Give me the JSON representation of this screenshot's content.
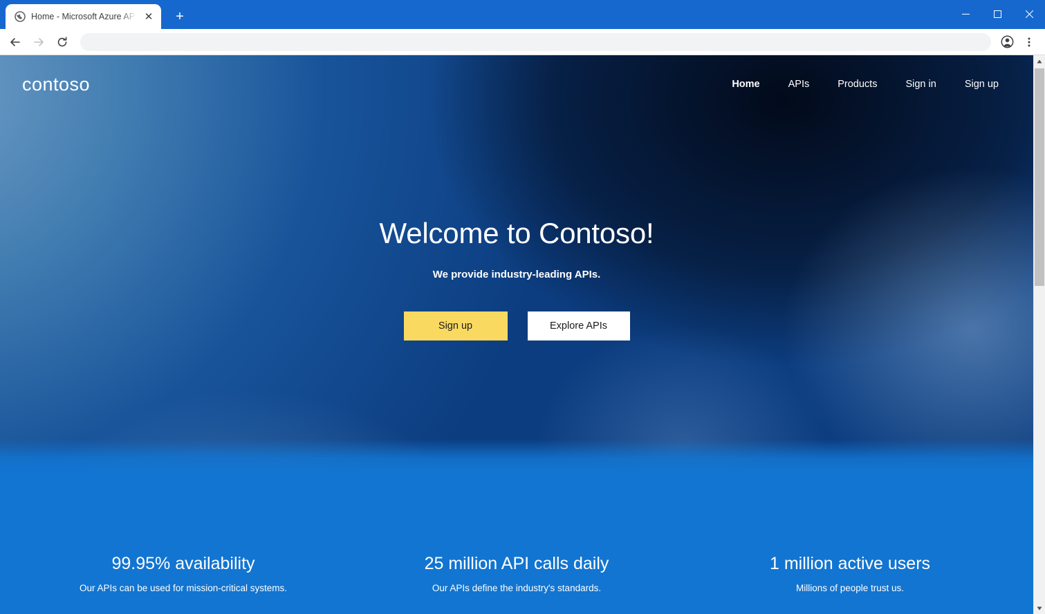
{
  "browser": {
    "tab": {
      "title": "Home - Microsoft Azure API Man",
      "favicon": "globe-icon",
      "close_label": "✕"
    },
    "new_tab_label": "+",
    "window_controls": {
      "minimize": "─",
      "maximize": "□",
      "close": "✕"
    },
    "toolbar": {
      "back": "back-arrow-icon",
      "forward": "forward-arrow-icon",
      "reload": "reload-icon",
      "address_value": "",
      "address_placeholder": "",
      "profile": "profile-avatar-icon",
      "menu": "three-dot-menu-icon"
    },
    "scrollbar": {
      "up_arrow": "▲",
      "down_arrow": "▼"
    }
  },
  "site": {
    "brand": "contoso",
    "nav": [
      {
        "label": "Home",
        "active": true
      },
      {
        "label": "APIs",
        "active": false
      },
      {
        "label": "Products",
        "active": false
      },
      {
        "label": "Sign in",
        "active": false
      },
      {
        "label": "Sign up",
        "active": false
      }
    ],
    "hero": {
      "title": "Welcome to Contoso!",
      "subtitle": "We provide industry-leading APIs.",
      "primary_button": "Sign up",
      "secondary_button": "Explore APIs"
    },
    "stats": [
      {
        "value": "99.95% availability",
        "description": "Our APIs can be used for mission-critical systems."
      },
      {
        "value": "25 million API calls daily",
        "description": "Our APIs define the industry's standards."
      },
      {
        "value": "1 million active users",
        "description": "Millions of people trust us."
      }
    ],
    "colors": {
      "accent_yellow": "#fad961",
      "band_blue": "#1275d1",
      "chrome_blue": "#1668ce",
      "hero_dark": "#061023"
    }
  }
}
